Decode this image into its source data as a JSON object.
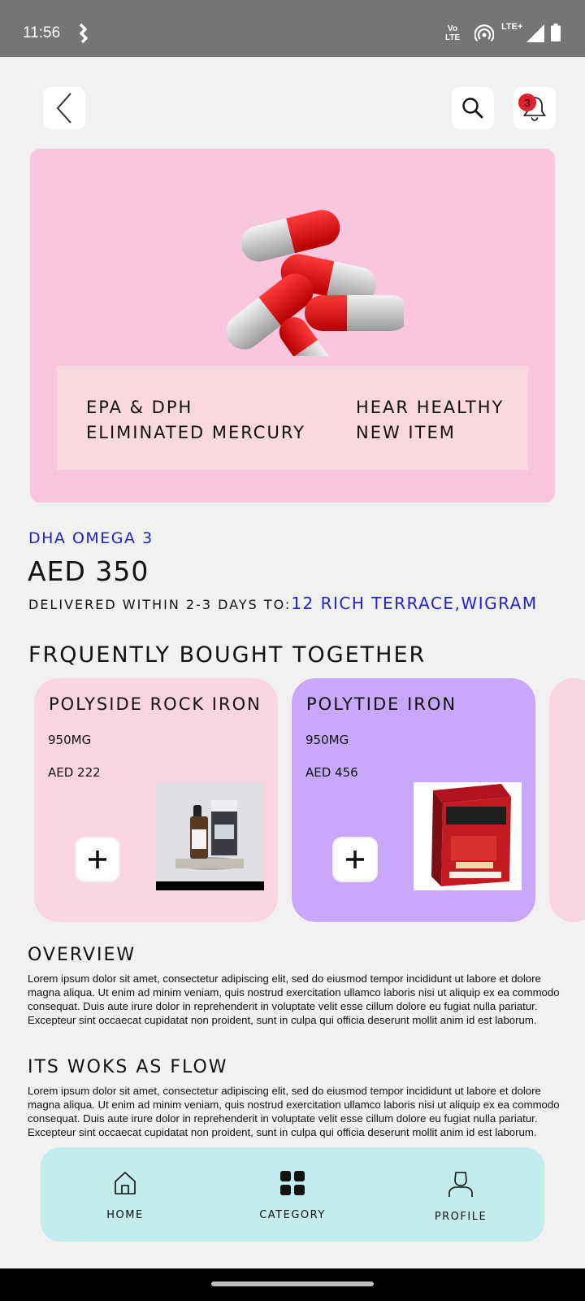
{
  "status_bar": {
    "time": "11:56",
    "volte_line1": "Vo",
    "volte_line2": "LTE",
    "network": "LTE+",
    "icons": [
      "app-notification-icon",
      "hotspot-icon",
      "signal-icon",
      "battery-icon"
    ]
  },
  "header": {
    "back_icon": "chevron-left-icon",
    "search_icon": "search-icon",
    "notification_icon": "bell-icon",
    "notification_count": "3"
  },
  "hero": {
    "image": "capsule-pills-image",
    "left_line1": "EPA & DPH",
    "left_line2": "ELIMINATED MERCURY",
    "right_line1": "HEAR HEALTHY",
    "right_line2": "NEW ITEM"
  },
  "product": {
    "name": "DHA OMEGA 3",
    "price": "AED 350",
    "delivery_prefix": "DELIVERED WITHIN 2-3 DAYS TO:",
    "delivery_address": "12 RICH TERRACE,WIGRAM"
  },
  "frequently_bought": {
    "title": "FRQUENTLY BOUGHT TOGETHER",
    "items": [
      {
        "name": "POLYSIDE ROCK IRON",
        "dose": "950MG",
        "price": "AED 222",
        "image": "dropper-bottle-image"
      },
      {
        "name": "POLYTIDE IRON",
        "dose": "950MG",
        "price": "AED 456",
        "image": "tensoplast-box-image"
      }
    ]
  },
  "overview": {
    "title": "OVERVIEW",
    "text": "Lorem ipsum dolor sit amet, consectetur adipiscing elit, sed do eiusmod tempor incididunt ut labore et dolore magna aliqua. Ut enim ad minim veniam, quis nostrud exercitation ullamco laboris nisi ut aliquip ex ea commodo consequat. Duis aute irure dolor in reprehenderit in voluptate velit esse cillum dolore eu fugiat nulla pariatur. Excepteur sint occaecat cupidatat non proident, sunt in culpa qui officia deserunt mollit anim id est laborum."
  },
  "flow": {
    "title": "ITS WOKS AS FLOW",
    "text": "Lorem ipsum dolor sit amet, consectetur adipiscing elit, sed do eiusmod tempor incididunt ut labore et dolore magna aliqua. Ut enim ad minim veniam, quis nostrud exercitation ullamco laboris nisi ut aliquip ex ea commodo consequat. Duis aute irure dolor in reprehenderit in voluptate velit esse cillum dolore eu fugiat nulla pariatur. Excepteur sint occaecat cupidatat non proident, sunt in culpa qui officia deserunt mollit anim id est laborum."
  },
  "bottom_nav": {
    "items": [
      {
        "label": "HOME",
        "icon": "home-icon"
      },
      {
        "label": "CATEGORY",
        "icon": "grid-icon"
      },
      {
        "label": "PROFILE",
        "icon": "person-icon"
      }
    ]
  },
  "colors": {
    "accent_blue": "#2323c8",
    "hero_bg": "#fac6de",
    "card_pink": "#fad5e0",
    "card_purple": "#c9a8fc",
    "nav_bg": "#c2ecee",
    "badge_red": "#e0202a"
  }
}
